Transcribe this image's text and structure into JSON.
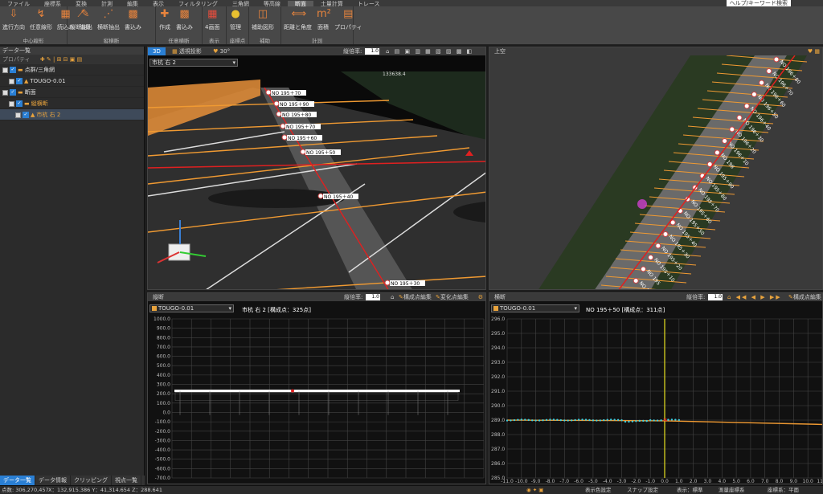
{
  "menu": [
    "ファイル",
    "座標系",
    "変換",
    "計測",
    "編集",
    "表示",
    "フィルタリング",
    "三角網",
    "等高線",
    "断面",
    "土量計算",
    "トレース"
  ],
  "menu_active": "断面",
  "title_right": "ヘルプ/キーワード検索",
  "ribbon": {
    "groups": [
      {
        "label": "中心線形",
        "buttons": [
          {
            "label": "進行方向",
            "icon": "arrow-icon"
          },
          {
            "label": "任意線形",
            "icon": "curve-icon"
          },
          {
            "label": "読込み",
            "icon": "load-icon"
          },
          {
            "label": "編集",
            "icon": "edit-icon"
          }
        ]
      },
      {
        "label": "縦横断",
        "buttons": [
          {
            "label": "縦断抽出",
            "icon": "profile-icon"
          },
          {
            "label": "横断抽出",
            "icon": "cross-icon"
          },
          {
            "label": "書込み",
            "icon": "write-icon"
          }
        ]
      },
      {
        "label": "任意横断",
        "buttons": [
          {
            "label": "作成",
            "icon": "create-icon"
          },
          {
            "label": "書込み",
            "icon": "write-icon"
          }
        ]
      },
      {
        "label": "表示",
        "buttons": [
          {
            "label": "4画面",
            "icon": "grid4-icon"
          }
        ]
      },
      {
        "label": "座標点",
        "buttons": [
          {
            "label": "管理",
            "icon": "points-icon"
          }
        ]
      },
      {
        "label": "補助",
        "buttons": [
          {
            "label": "補助図形",
            "icon": "shape-icon"
          }
        ]
      },
      {
        "label": "計測",
        "buttons": [
          {
            "label": "距離と角度",
            "icon": "distance-icon"
          },
          {
            "label": "面積",
            "icon": "area-icon"
          },
          {
            "label": "プロパティ",
            "icon": "table-icon"
          }
        ]
      }
    ]
  },
  "left_panel": {
    "title": "データ一覧",
    "toolbar_label": "プロパティ",
    "tree": [
      {
        "level": 0,
        "label": "点群/三角網",
        "type": "folder"
      },
      {
        "level": 1,
        "label": "TOUGO-0.01",
        "type": "item"
      },
      {
        "level": 0,
        "label": "断面",
        "type": "folder"
      },
      {
        "level": 1,
        "label": "縦横断",
        "type": "folder-orange"
      },
      {
        "level": 2,
        "label": "市杭 右 2",
        "type": "item-orange"
      }
    ],
    "tabs": [
      "データ一覧",
      "データ情報",
      "クリッピング",
      "視点一覧"
    ]
  },
  "pane_3d": {
    "tabs": [
      "3D",
      "透視投影",
      "30°"
    ],
    "ratio_label": "縦倍率:",
    "ratio_value": "1.0",
    "combo": "市杭 右 2",
    "coord_text": "133638.4",
    "stations": [
      "NO 195＋70",
      "NO 195＋90",
      "NO 195＋80",
      "NO 195＋70",
      "NO 195＋60",
      "NO 195＋50",
      "NO 195＋40",
      "NO 195＋30",
      "NO 195＋20"
    ],
    "colors": {
      "road": "#2f2f2f",
      "orange": "#f09a32",
      "red": "#e02020"
    }
  },
  "pane_top": {
    "tab": "上空",
    "stations": [
      "NO 196＋80",
      "NO 196＋70",
      "NO 196＋60",
      "NO 196＋50",
      "NO 196＋40",
      "NO 196＋30",
      "NO 196＋20",
      "NO 196＋10",
      "NO 196",
      "NO 195＋90",
      "NO 195＋80",
      "NO 195＋70",
      "NO 195＋60",
      "NO 195＋50",
      "NO 195＋40",
      "NO 195＋30",
      "NO 195＋20",
      "NO 195＋10",
      "NO 195",
      "NO 194＋90"
    ]
  },
  "pane_profile": {
    "tab": "縦断",
    "ratio_label": "縦倍率:",
    "ratio_value": "1.0",
    "edit1": "構成点編集",
    "edit2": "変化点編集",
    "combo": "TOUGO-0.01",
    "caption": "市杭 右 2 [構成点：325点]",
    "y_ticks": [
      "1000.0",
      "900.0",
      "800.0",
      "700.0",
      "600.0",
      "500.0",
      "400.0",
      "300.0",
      "200.0",
      "100.0",
      "0.0",
      "-100.0",
      "-200.0",
      "-300.0",
      "-400.0",
      "-500.0",
      "-600.0",
      "-700.0"
    ]
  },
  "pane_cross": {
    "tab": "横断",
    "ratio_label": "縦倍率:",
    "ratio_value": "1.0",
    "edit1": "構成点編集",
    "combo": "TOUGO-0.01",
    "caption": "NO 195＋50 [構成点：311点]",
    "y_ticks": [
      "296.0",
      "295.0",
      "294.0",
      "293.0",
      "292.0",
      "291.0",
      "290.0",
      "289.0",
      "288.0",
      "287.0",
      "286.0",
      "285.0"
    ],
    "x_ticks": [
      "-11.0",
      "-10.0",
      "-9.0",
      "-8.0",
      "-7.0",
      "-6.0",
      "-5.0",
      "-4.0",
      "-3.0",
      "-2.0",
      "-1.0",
      "0.0",
      "1.0",
      "2.0",
      "3.0",
      "4.0",
      "5.0",
      "6.0",
      "7.0",
      "8.0",
      "9.0",
      "10.0",
      "11.0"
    ]
  },
  "status": {
    "points": "点数: 306,270,457",
    "coords": "X：132,915.386  Y：41,314.654  Z：288.641",
    "items": [
      "表示色設定",
      "スナップ設定",
      "表示：標準",
      "測量座標系",
      "座標系：平面"
    ]
  }
}
